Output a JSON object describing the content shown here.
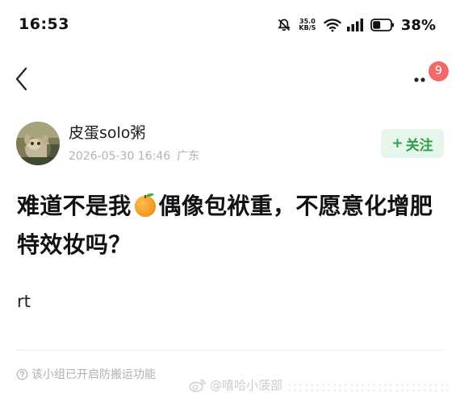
{
  "status_bar": {
    "time": "16:53",
    "net_speed_value": "35.0",
    "net_speed_unit": "KB/S",
    "battery_percent": "38%",
    "icons": [
      "mute-bell-icon",
      "wifi-icon",
      "signal-icon",
      "battery-icon"
    ]
  },
  "nav": {
    "back_icon": "chevron-left-icon",
    "more_icon": "more-dots-icon",
    "badge_count": "9",
    "badge_color": "#f06a6a"
  },
  "author": {
    "name": "皮蛋solo粥",
    "date": "2026-05-30 16:46",
    "location": "广东"
  },
  "follow": {
    "plus": "+",
    "label": "关注",
    "text_color": "#2e9e47",
    "bg_color": "#e7f6ea"
  },
  "post": {
    "title_part1": "难道不是我",
    "title_emoji": "orange-emoji",
    "title_part2": "偶像包袱重，不愿意化增肥特效妆吗？",
    "body": "rt"
  },
  "footer": {
    "note_icon": "question-circle-icon",
    "note": "该小组已开启防搬运功能"
  },
  "watermark": {
    "icon": "weibo-icon",
    "text": "@嘻哈小菠部"
  }
}
